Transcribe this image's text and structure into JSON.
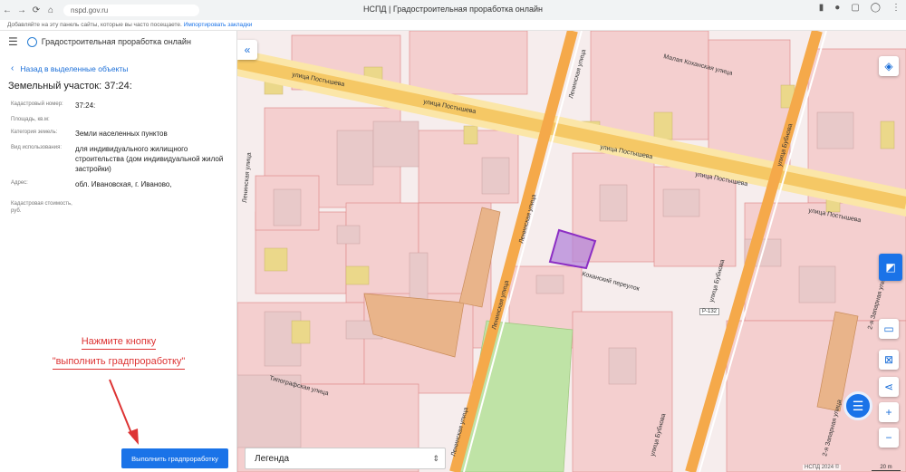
{
  "browser": {
    "url": "nspd.gov.ru",
    "tab_title": "НСПД | Градостроительная проработка онлайн",
    "bookmarks_prompt": "Добавляйте на эту панель сайты, которые вы часто посещаете.",
    "bookmarks_import": "Импортировать закладки"
  },
  "sidebar": {
    "app_title": "Градостроительная проработка онлайн",
    "back_label": "Назад в выделенные объекты",
    "parcel_title": "Земельный участок: 37:24:",
    "properties": [
      {
        "label": "Кадастровый номер:",
        "value": "37:24:"
      },
      {
        "label": "Площадь, кв.м:",
        "value": ""
      },
      {
        "label": "Категория земель:",
        "value": "Земли населенных пунктов"
      },
      {
        "label": "Вид использования:",
        "value": "для индивидуального жилищного строительства (дом индивидуальной жилой застройки)"
      },
      {
        "label": "Адрес:",
        "value": "обл. Ивановская, г. Иваново,"
      },
      {
        "label": "Кадастровая стоимость, руб.",
        "value": ""
      }
    ],
    "annotation_line1": "Нажмите кнопку",
    "annotation_line2": "\"выполнить градпроработку\"",
    "run_button_label": "Выполнить градпроработку"
  },
  "map": {
    "legend_label": "Легенда",
    "copyright": "НСПД 2024 ©",
    "scale": "20 m",
    "road_badge": "Р-132",
    "streets": {
      "postysheva_1": "улица Постышева",
      "postysheva_2": "улица Постышева",
      "postysheva_3": "улица Постышева",
      "postysheva_4": "улица Постышева",
      "postysheva_5": "улица Постышева",
      "leninskaya_1": "Ленинская улица",
      "leninskaya_2": "Ленинская улица",
      "leninskaya_3": "Ленинская улица",
      "leninskaya_4": "Ленинская улица",
      "bubnova_1": "улица Бубнова",
      "bubnova_2": "улица Бубнова",
      "bubnova_3": "улица Бубнова",
      "kokhanskiy": "Коханский переулок",
      "maly_kokhanskiy": "Малая Коханская улица",
      "tipografskaya": "Типографская улица",
      "zaparnaya_1": "2-я Запарная улица",
      "zaparnaya_2": "2-я Запарная улица",
      "leninskaya_short": "Ленинская улица"
    }
  },
  "colors": {
    "accent": "#1a73e8",
    "annotation": "#dd3333",
    "road": "#f5a94a",
    "selected_parcel": "#8c2ec4"
  }
}
